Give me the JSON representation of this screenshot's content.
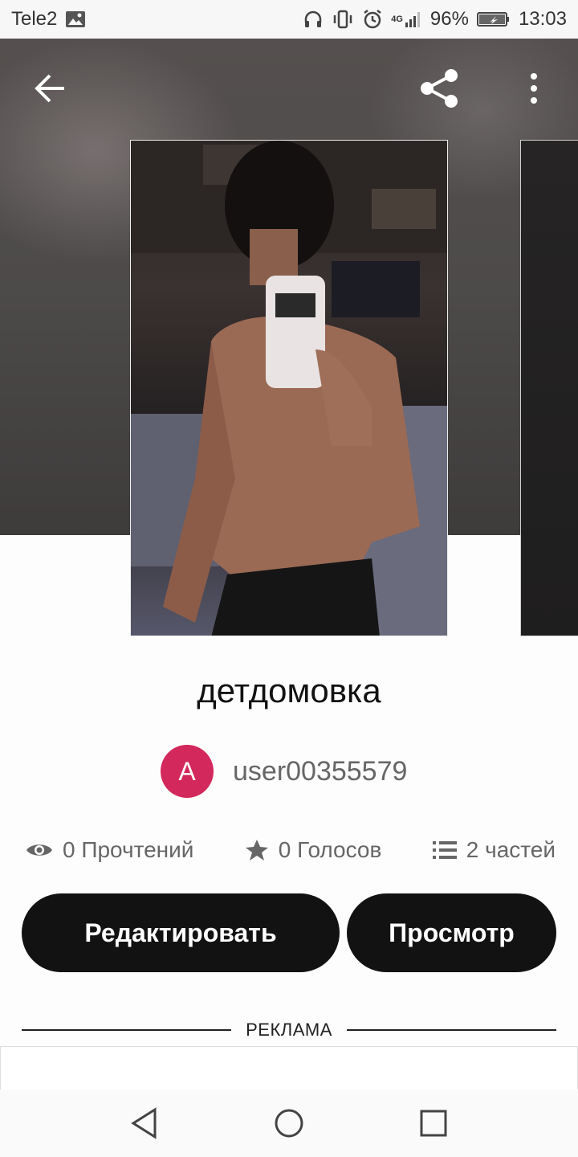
{
  "status_bar": {
    "carrier": "Tele2",
    "network": "4G",
    "battery": "96%",
    "time": "13:03",
    "icons": [
      "image-icon",
      "headphones-icon",
      "vibrate-icon",
      "alarm-icon",
      "signal-icon",
      "battery-icon"
    ]
  },
  "header": {
    "back_icon": "arrow-left-icon",
    "share_icon": "share-icon",
    "more_icon": "more-vertical-icon"
  },
  "story": {
    "title": "детдомовка",
    "author": {
      "avatar_letter": "A",
      "avatar_color": "#d3285c",
      "username": "user00355579"
    },
    "stats": {
      "reads": "0 Прочтений",
      "votes": "0 Голосов",
      "parts": "2 частей"
    }
  },
  "actions": {
    "edit_label": "Редактировать",
    "view_label": "Просмотр"
  },
  "ad": {
    "label": "РЕКЛАМА"
  },
  "nav": {
    "icons": [
      "nav-back-icon",
      "nav-home-icon",
      "nav-recent-icon"
    ]
  },
  "colors": {
    "button_bg": "#121212",
    "accent_avatar": "#d3285c"
  }
}
